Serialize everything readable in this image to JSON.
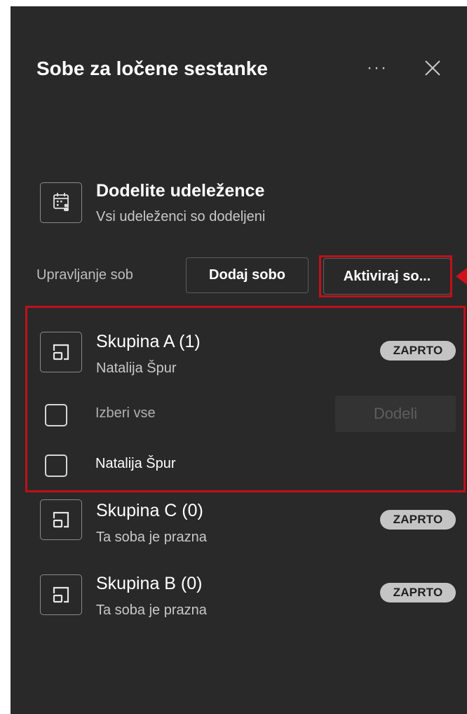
{
  "header": {
    "title": "Sobe za ločene sestanke",
    "more_glyph": "···",
    "more_icon": "more-horizontal-icon",
    "close_icon": "close-icon"
  },
  "assign": {
    "title": "Dodelite udeležence",
    "subtitle": "Vsi udeleženci so dodeljeni",
    "icon": "calendar-people-icon"
  },
  "manage": {
    "label": "Upravljanje sob",
    "add_room": "Dodaj sobo",
    "activate": "Aktiviraj so..."
  },
  "rooms": [
    {
      "name": "Skupina A (1)",
      "subtitle": "Natalija Špur",
      "status": "ZAPRTO",
      "expanded": true,
      "select_all": "Izberi vse",
      "assign_button": "Dodeli",
      "members": [
        "Natalija Špur"
      ]
    },
    {
      "name": "Skupina C (0)",
      "subtitle": "Ta soba je prazna",
      "status": "ZAPRTO"
    },
    {
      "name": "Skupina B (0)",
      "subtitle": "Ta soba je prazna",
      "status": "ZAPRTO"
    }
  ],
  "colors": {
    "panel_bg": "#292929",
    "highlight": "#c0101a",
    "badge_bg": "#c4c4c4"
  }
}
